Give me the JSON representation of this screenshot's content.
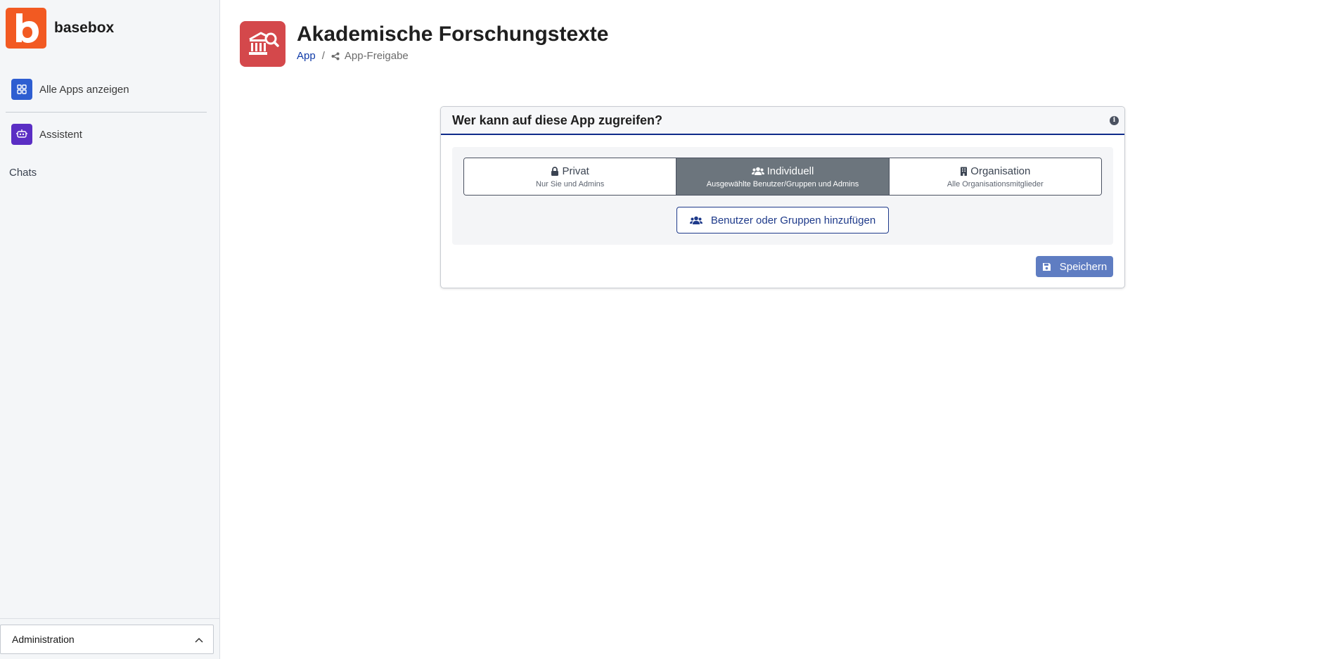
{
  "brand": {
    "name": "basebox",
    "logo_letter": "b",
    "color": "#f25a22"
  },
  "sidebar": {
    "items": [
      {
        "label": "Alle Apps anzeigen",
        "icon": "grid-icon",
        "color": "#2e5ed1"
      },
      {
        "label": "Assistent",
        "icon": "assistant-icon",
        "color": "#5a2ec4"
      }
    ],
    "section_label": "Chats",
    "footer": {
      "label": "Administration",
      "icon": "chevron-up-icon"
    }
  },
  "header": {
    "title": "Akademische Forschungstexte",
    "app_icon": "museum-search-icon",
    "app_icon_color": "#d4484b",
    "breadcrumb": {
      "link": "App",
      "separator": "/",
      "current": "App-Freigabe",
      "current_icon": "share-icon"
    }
  },
  "card": {
    "title": "Wer kann auf diese App zugreifen?",
    "info_icon": "info-icon",
    "options": [
      {
        "title": "Privat",
        "subtitle": "Nur Sie und Admins",
        "icon": "lock-icon",
        "active": false
      },
      {
        "title": "Individuell",
        "subtitle": "Ausgewählte Benutzer/Gruppen und Admins",
        "icon": "users-icon",
        "active": true
      },
      {
        "title": "Organisation",
        "subtitle": "Alle Organisationsmitglieder",
        "icon": "building-icon",
        "active": false
      }
    ],
    "add_button": "Benutzer oder Gruppen hinzufügen",
    "save_button": "Speichern"
  },
  "colors": {
    "accent": "#0f2b8a",
    "active_segment": "#6c757d",
    "save_button": "#5f7dc2"
  }
}
